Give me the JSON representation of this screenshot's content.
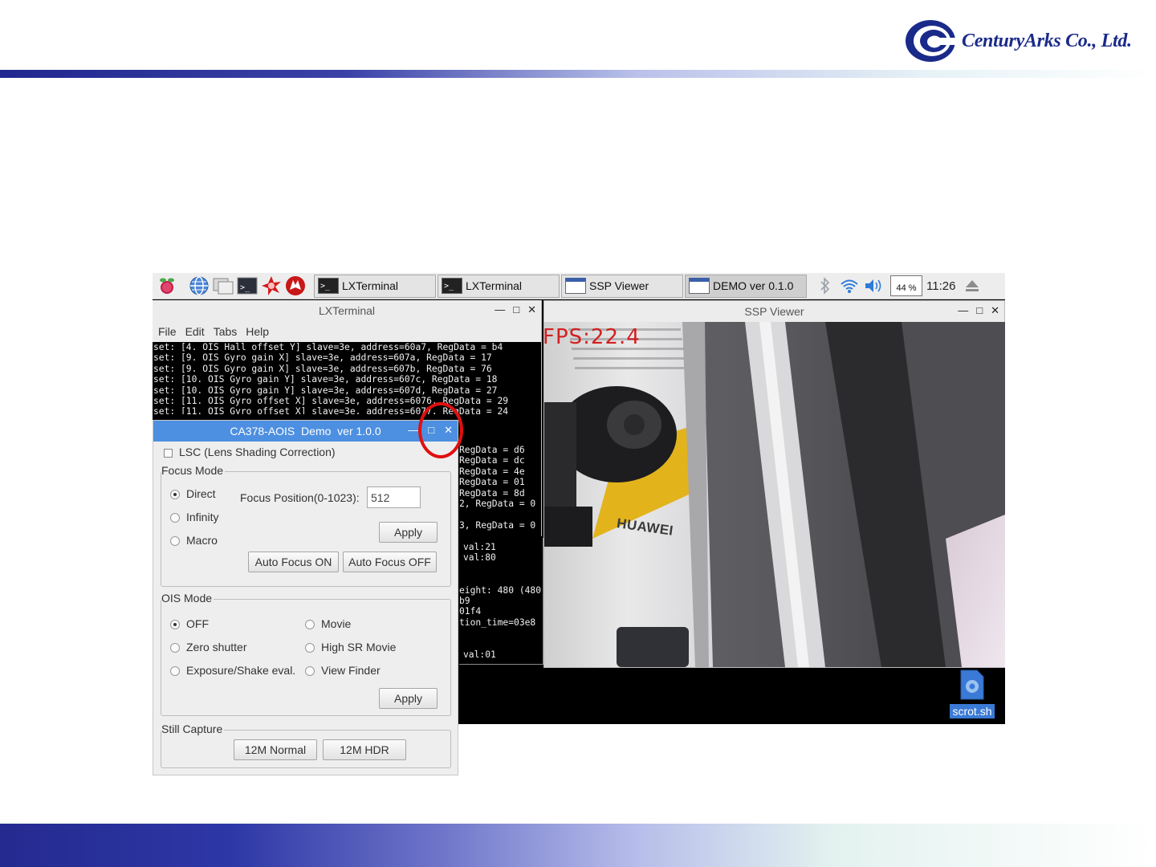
{
  "branding": {
    "company": "CenturyArks Co., Ltd."
  },
  "taskbar": {
    "tasks": [
      {
        "label": "LXTerminal"
      },
      {
        "label": "LXTerminal"
      },
      {
        "label": "SSP Viewer"
      },
      {
        "label": "DEMO ver 0.1.0"
      }
    ],
    "cpu_text": "44 %",
    "clock": "11:26"
  },
  "lxterminal": {
    "title": "LXTerminal",
    "menu": [
      "File",
      "Edit",
      "Tabs",
      "Help"
    ],
    "lines": [
      "set: [4. OIS Hall offset Y] slave=3e, address=60a7, RegData = b4",
      "set: [9. OIS Gyro gain X] slave=3e, address=607a, RegData = 17",
      "set: [9. OIS Gyro gain X] slave=3e, address=607b, RegData = 76",
      "set: [10. OIS Gyro gain Y] slave=3e, address=607c, RegData = 18",
      "set: [10. OIS Gyro gain Y] slave=3e, address=607d, RegData = 27",
      "set: [11. OIS Gyro offset X] slave=3e, address=6076, RegData = 29",
      "set: [11. OIS Gyro offset X] slave=3e, address=6077, RegData = 24"
    ],
    "peek_lines": [
      "RegData = d6",
      "RegData = dc",
      "RegData = 4e",
      "RegData = 01",
      "RegData = 8d",
      "2, RegData = 0",
      "",
      "3, RegData = 0"
    ]
  },
  "terminal2_peek": [
    {
      "text": "val:21"
    },
    {
      "text": "val:80"
    },
    {
      "text": ""
    },
    {
      "text": ""
    },
    {
      "text": "eight: 480 (480"
    },
    {
      "text": "b9"
    },
    {
      "text": "01f4"
    },
    {
      "text": "tion_time=03e8"
    },
    {
      "text": ""
    },
    {
      "text": ""
    },
    {
      "text": "val:01"
    }
  ],
  "ssp_viewer": {
    "title": "SSP Viewer",
    "fps_overlay": "FPS:22.4",
    "brand_in_image": "HUAWEI"
  },
  "desktop_file": {
    "label": "scrot.sh"
  },
  "dialog": {
    "title": "CA378-AOIS  Demo  ver 1.0.0",
    "lsc_label": "LSC (Lens Shading Correction)",
    "focus": {
      "group_label": "Focus Mode",
      "options": [
        "Direct",
        "Infinity",
        "Macro"
      ],
      "selected": "Direct",
      "position_label": "Focus Position(0-1023):",
      "position_value": "512",
      "apply_label": "Apply",
      "af_on_label": "Auto Focus ON",
      "af_off_label": "Auto Focus OFF"
    },
    "ois": {
      "group_label": "OIS Mode",
      "options_left": [
        "OFF",
        "Zero shutter",
        "Exposure/Shake eval."
      ],
      "options_right": [
        "Movie",
        "High SR Movie",
        "View Finder"
      ],
      "selected": "OFF",
      "apply_label": "Apply"
    },
    "still": {
      "group_label": "Still Capture",
      "normal_label": "12M Normal",
      "hdr_label": "12M HDR"
    }
  },
  "colors": {
    "accent_blue": "#4d8fe0",
    "highlight_circle": "#e01010",
    "logo_navy": "#1a2a8a",
    "fps_red": "#d22020"
  }
}
